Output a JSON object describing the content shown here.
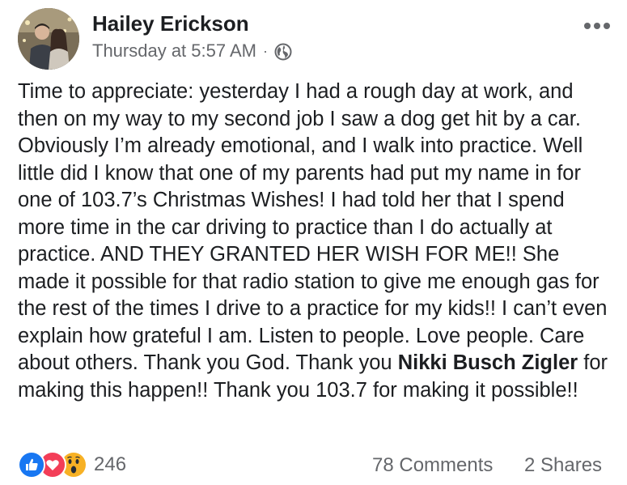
{
  "post": {
    "author": "Hailey Erickson",
    "timestamp": "Thursday at 5:57 AM",
    "separator": "·",
    "privacy_icon": "globe-icon",
    "more_icon": "more-options-icon",
    "body": {
      "text_before_mention": "Time to appreciate: yesterday I had a rough day at work, and then on my way to my second job I saw a dog get hit by a car. Obviously I’m already emotional, and I walk into practice. Well little did I know that one of my parents had put my name in for one of 103.7’s Christmas Wishes! I had told her that I spend more time in the car driving to practice than I do actually at practice. AND THEY GRANTED HER WISH FOR ME!! She made it possible for that radio station to give me enough gas for the rest of the times I drive to a practice for my kids!! I can’t even explain how grateful I am. Listen to people. Love people. Care about others. Thank you God. Thank you ",
      "mention": "Nikki Busch Zigler",
      "text_after_mention": "  for making this happen!! Thank you 103.7 for making it possible!!"
    }
  },
  "footer": {
    "reactions": [
      "like-icon",
      "love-icon",
      "wow-icon"
    ],
    "reaction_count": "246",
    "comments": "78 Comments",
    "shares": "2 Shares"
  },
  "colors": {
    "like": "#1877f2",
    "love": "#f33e58",
    "wow": "#f7b125",
    "secondary_text": "#65676b"
  }
}
